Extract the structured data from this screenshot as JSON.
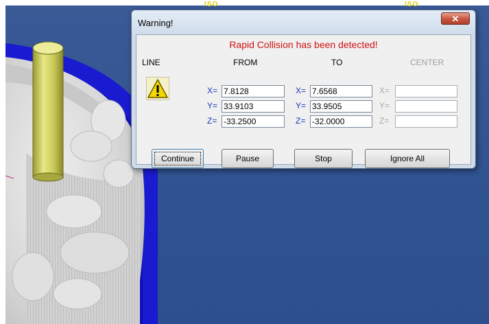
{
  "scene": {
    "iso_labels": [
      "ISO",
      "ISO"
    ]
  },
  "dialog": {
    "title": "Warning!",
    "close_glyph": "✕",
    "message": "Rapid Collision has been detected!",
    "columns": {
      "line": "LINE",
      "from": "FROM",
      "to": "TO",
      "center": "CENTER"
    },
    "icon": "warning-icon",
    "from": {
      "x_label": "X=",
      "x": "7.8128",
      "y_label": "Y=",
      "y": "33.9103",
      "z_label": "Z=",
      "z": "-33.2500"
    },
    "to": {
      "x_label": "X=",
      "x": "7.6568",
      "y_label": "Y=",
      "y": "33.9505",
      "z_label": "Z=",
      "z": "-32.0000"
    },
    "center": {
      "x_label": "X=",
      "x": "",
      "y_label": "Y=",
      "y": "",
      "z_label": "Z=",
      "z": ""
    },
    "buttons": {
      "continue": "Continue",
      "pause": "Pause",
      "stop": "Stop",
      "ignore_all": "Ignore All"
    }
  },
  "colors": {
    "background": "#33508a",
    "message": "#d01010",
    "fixture": "#1a1ad0",
    "tool": "#d8d870"
  }
}
